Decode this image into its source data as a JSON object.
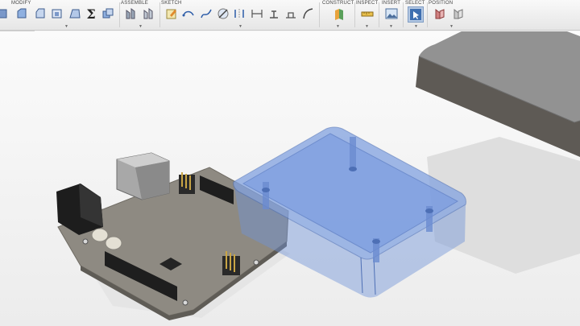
{
  "toolbar": {
    "groups": [
      {
        "label": "MODIFY"
      },
      {
        "label": "ASSEMBLE"
      },
      {
        "label": "SKETCH"
      },
      {
        "label": "CONSTRUCT"
      },
      {
        "label": "INSPECT"
      },
      {
        "label": "INSERT"
      },
      {
        "label": "SELECT"
      },
      {
        "label": "POSITION"
      }
    ],
    "sum_symbol": "Σ"
  },
  "colors": {
    "enclosure_blue": "#6f93d8",
    "lid_gray": "#8c8c8c",
    "pcb": "#8f8b82",
    "header_black": "#1e1e1e",
    "gold": "#c9a545",
    "background": "#f4f4f4"
  }
}
